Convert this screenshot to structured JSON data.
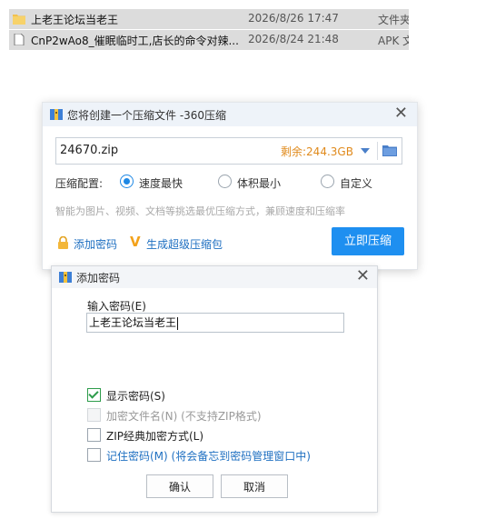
{
  "files": [
    {
      "name": "上老王论坛当老王",
      "date": "2026/8/26 17:47",
      "type": "文件夹",
      "icon": "folder-icon"
    },
    {
      "name": "CnP2wAo8_催眠临时工,店长的命令对辣...",
      "date": "2026/8/24 21:48",
      "type": "APK 文",
      "icon": "file-icon"
    }
  ],
  "compress_dialog": {
    "title": "您将创建一个压缩文件 -360压缩",
    "filename": "24670.zip",
    "free_space": "剩余:244.3GB",
    "config_label": "压缩配置:",
    "options": [
      {
        "label": "速度最快",
        "selected": true
      },
      {
        "label": "体积最小",
        "selected": false
      },
      {
        "label": "自定义",
        "selected": false
      }
    ],
    "hint": "智能为图片、视频、文档等挑选最优压缩方式，兼顾速度和压缩率",
    "add_password_link": "添加密码",
    "super_pack_link": "生成超级压缩包",
    "compress_button": "立即压缩",
    "colors": {
      "accent": "#1e8ff0",
      "space": "#e08a1c",
      "link": "#1e6fc1"
    }
  },
  "password_dialog": {
    "title": "添加密码",
    "input_label": "输入密码(E)",
    "password_value": "上老王论坛当老王",
    "checkboxes": [
      {
        "label": "显示密码(S)",
        "checked": true,
        "enabled": true
      },
      {
        "label": "加密文件名(N) (不支持ZIP格式)",
        "checked": false,
        "enabled": false
      },
      {
        "label": "ZIP经典加密方式(L)",
        "checked": false,
        "enabled": true
      },
      {
        "label": "记住密码(M) (将会备忘到密码管理窗口中)",
        "checked": false,
        "enabled": true
      }
    ],
    "ok_button": "确认",
    "cancel_button": "取消"
  }
}
